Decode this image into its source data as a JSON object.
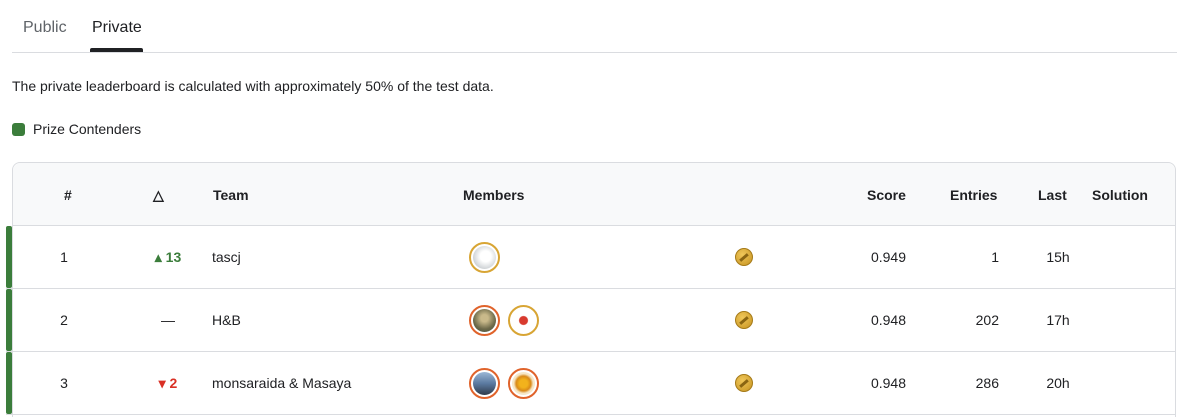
{
  "tabs": [
    {
      "label": "Public"
    },
    {
      "label": "Private"
    }
  ],
  "note": "The private leaderboard is calculated with approximately 50% of the test data.",
  "legend": {
    "label": "Prize Contenders",
    "color": "#3b7d3b"
  },
  "columns": {
    "rank": "#",
    "delta": "△",
    "team": "Team",
    "members": "Members",
    "score": "Score",
    "entries": "Entries",
    "last": "Last",
    "solution": "Solution"
  },
  "rows": [
    {
      "rank": "1",
      "delta": "▴ 13",
      "delta_dir": "up",
      "team": "tascj",
      "score": "0.949",
      "entries": "1",
      "last": "15h",
      "member_icons": [
        "avatar-white"
      ],
      "medal": "gold-medal-icon"
    },
    {
      "rank": "2",
      "delta": "—",
      "delta_dir": "none",
      "team": "H&B",
      "score": "0.948",
      "entries": "202",
      "last": "17h",
      "member_icons": [
        "avatar-photo",
        "liverpool-crest"
      ],
      "medal": "gold-medal-icon"
    },
    {
      "rank": "3",
      "delta": "▾ 2",
      "delta_dir": "down",
      "team": "monsaraida & Masaya",
      "score": "0.948",
      "entries": "286",
      "last": "20h",
      "member_icons": [
        "avatar-landscape",
        "avatar-sun"
      ],
      "medal": "gold-medal-icon"
    }
  ]
}
